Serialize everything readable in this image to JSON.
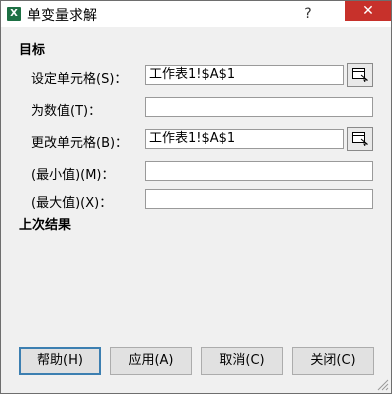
{
  "window": {
    "title": "单变量求解",
    "app_icon": "excel-icon",
    "help_label": "?",
    "close_label": "✕"
  },
  "sections": {
    "target": "目标",
    "last_result": "上次结果"
  },
  "fields": {
    "set_cell": {
      "label": "设定单元格(S)：",
      "value": "工作表1!$A$1"
    },
    "to_value": {
      "label": "为数值(T)：",
      "value": ""
    },
    "changing_cell": {
      "label": "更改单元格(B)：",
      "value": "工作表1!$A$1"
    },
    "min_value": {
      "label": "(最小值)(M)：",
      "value": ""
    },
    "max_value": {
      "label": "(最大值)(X)：",
      "value": ""
    }
  },
  "buttons": {
    "help": "帮助(H)",
    "apply": "应用(A)",
    "cancel": "取消(C)",
    "close": "关闭(C)"
  }
}
